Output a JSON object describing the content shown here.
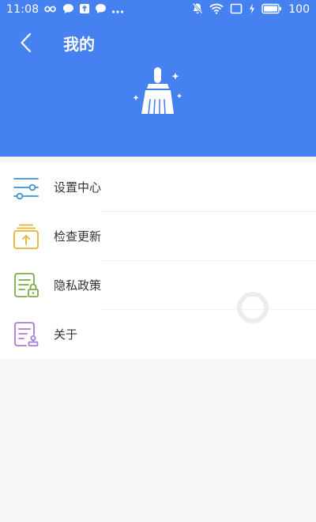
{
  "status_bar": {
    "time": "11:08",
    "left_icons": [
      "infinity-icon",
      "chat-bubble-icon",
      "upload-box-icon",
      "chat-bubble-icon",
      "more-dots-icon"
    ],
    "right_icons": [
      "mute-icon",
      "wifi-icon",
      "screen-cast-icon",
      "charging-icon",
      "battery-icon"
    ],
    "battery_level": "100"
  },
  "header": {
    "title": "我的",
    "back_icon": "chevron-left-icon",
    "illustration": "broom-icon"
  },
  "menu": {
    "items": [
      {
        "label": "设置中心",
        "icon": "sliders-icon"
      },
      {
        "label": "检查更新",
        "icon": "update-box-icon"
      },
      {
        "label": "隐私政策",
        "icon": "document-lock-icon"
      },
      {
        "label": "关于",
        "icon": "document-stamp-icon"
      }
    ]
  },
  "colors": {
    "header_bg": "#4581f0",
    "page_bg": "#f6f6f6",
    "menu_bg": "#ffffff",
    "text_primary": "#333333",
    "icon_settings": "#3f8fd9",
    "icon_update": "#e5b338",
    "icon_privacy": "#7eaa4a",
    "icon_about": "#a97ad6"
  }
}
